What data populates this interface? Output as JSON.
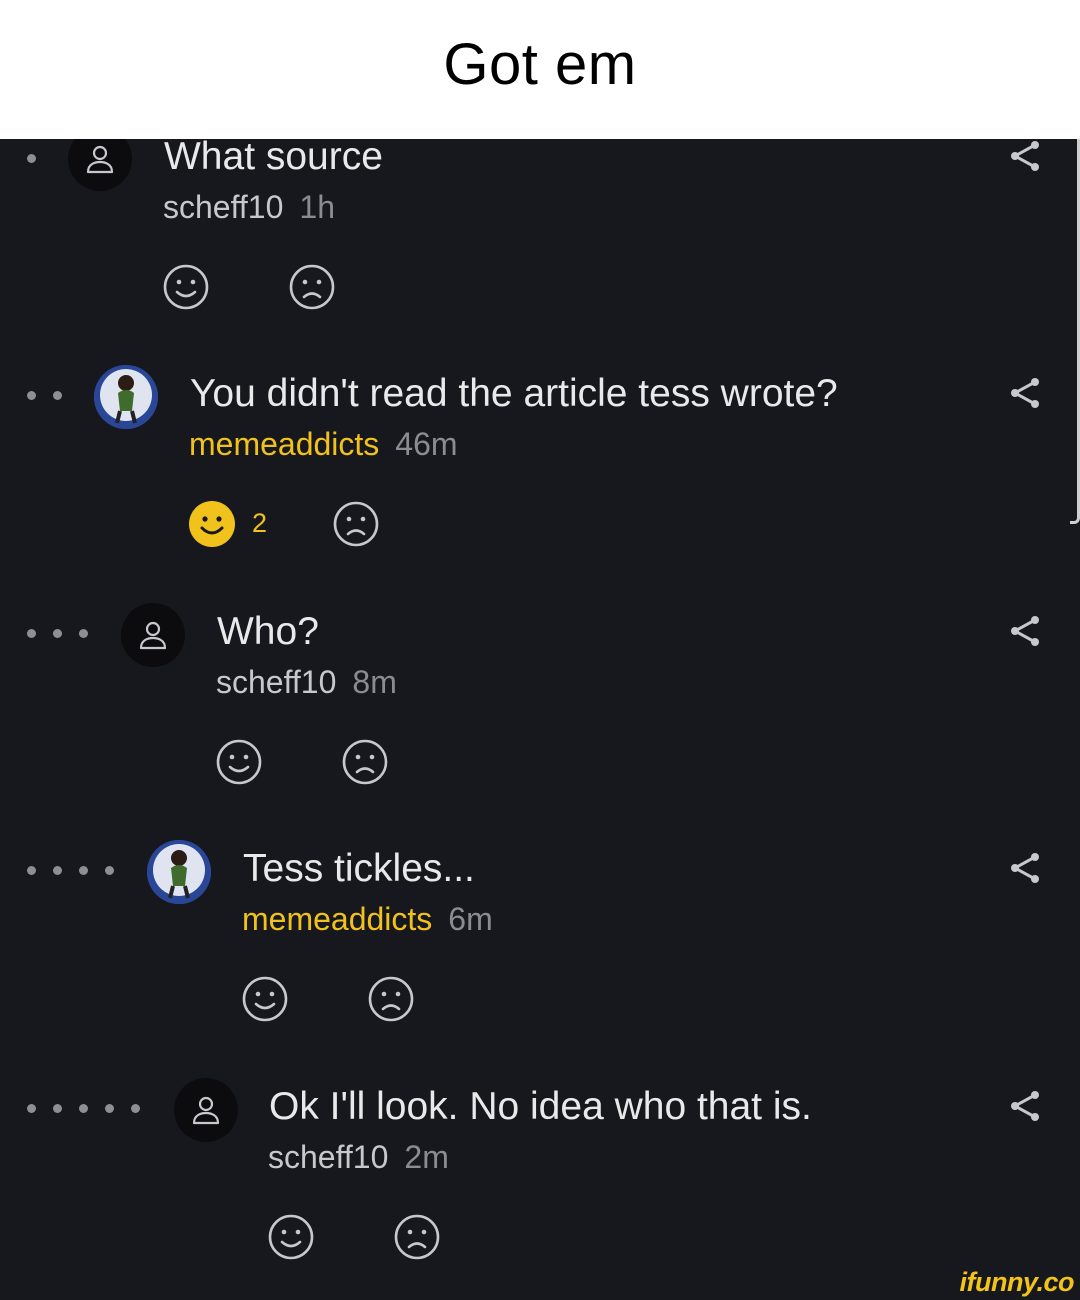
{
  "caption": "Got em",
  "watermark": "ifunny.co",
  "colors": {
    "background": "#17181d",
    "gold": "#f1c21c",
    "icon_gray": "#c8c8cc"
  },
  "comments": [
    {
      "text": "What source",
      "user": "scheff10",
      "time": "1h",
      "depth": 1,
      "avatar": "person-icon",
      "highlight_user": false,
      "liked": false,
      "likes": ""
    },
    {
      "text": "You didn't read the article tess wrote?",
      "user": "memeaddicts",
      "time": "46m",
      "depth": 2,
      "avatar": "profile-picture",
      "highlight_user": true,
      "liked": true,
      "likes": "2"
    },
    {
      "text": "Who?",
      "user": "scheff10",
      "time": "8m",
      "depth": 3,
      "avatar": "person-icon",
      "highlight_user": false,
      "liked": false,
      "likes": ""
    },
    {
      "text": "Tess tickles...",
      "user": "memeaddicts",
      "time": "6m",
      "depth": 4,
      "avatar": "profile-picture",
      "highlight_user": true,
      "liked": false,
      "likes": ""
    },
    {
      "text": "Ok I'll look. No idea who that is.",
      "user": "scheff10",
      "time": "2m",
      "depth": 5,
      "avatar": "person-icon",
      "highlight_user": false,
      "liked": false,
      "likes": ""
    }
  ]
}
